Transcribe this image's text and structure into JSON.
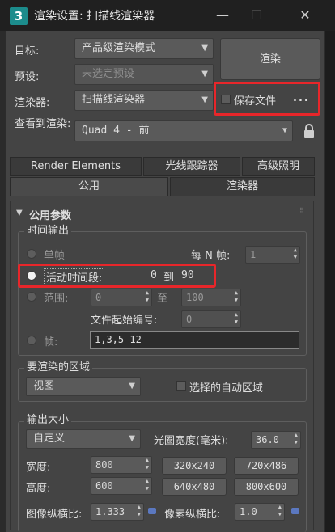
{
  "window": {
    "app_icon": "3",
    "title": "渲染设置: 扫描线渲染器",
    "minimize_icon": "minimize-icon",
    "maximize_icon": "maximize-icon",
    "close_icon": "close-icon",
    "min_glyph": "—",
    "max_glyph": "☐",
    "close_glyph": "✕"
  },
  "header": {
    "target_label": "目标:",
    "target_value": "产品级渲染模式",
    "preset_label": "预设:",
    "preset_value": "未选定预设",
    "renderer_label": "渲染器:",
    "renderer_value": "扫描线渲染器",
    "view_label": "查看到渲染:",
    "view_value": "Quad 4 - 前",
    "render_button": "渲染",
    "save_file_label": "保存文件",
    "browse_label": "..."
  },
  "tabs_row1": [
    "Render Elements",
    "光线跟踪器",
    "高级照明"
  ],
  "tabs_row2": [
    "公用",
    "渲染器"
  ],
  "rollout": {
    "title": "公用参数",
    "time_output": {
      "title": "时间输出",
      "single_label": "单帧",
      "every_n_label": "每 N 帧:",
      "every_n_value": "1",
      "active_segment_label": "活动时间段:",
      "active_from": "0",
      "active_to_label": "到",
      "active_to": "90",
      "range_label": "范围:",
      "range_start": "0",
      "range_to_label": "至",
      "range_end": "100",
      "file_start_label": "文件起始编号:",
      "file_start_value": "0",
      "frames_label": "帧:",
      "frames_value": "1,3,5-12"
    },
    "render_area": {
      "title": "要渲染的区域",
      "value": "视图",
      "auto_region_label": "选择的自动区域"
    },
    "output_size": {
      "title": "输出大小",
      "preset_value": "自定义",
      "aperture_label": "光圈宽度(毫米):",
      "aperture_value": "36.0",
      "width_label": "宽度:",
      "width_value": "800",
      "height_label": "高度:",
      "height_value": "600",
      "presets": [
        "320x240",
        "720x486",
        "640x480",
        "800x600"
      ],
      "image_aspect_label": "图像纵横比:",
      "image_aspect_value": "1.333",
      "pixel_aspect_label": "像素纵横比:",
      "pixel_aspect_value": "1.0"
    }
  }
}
